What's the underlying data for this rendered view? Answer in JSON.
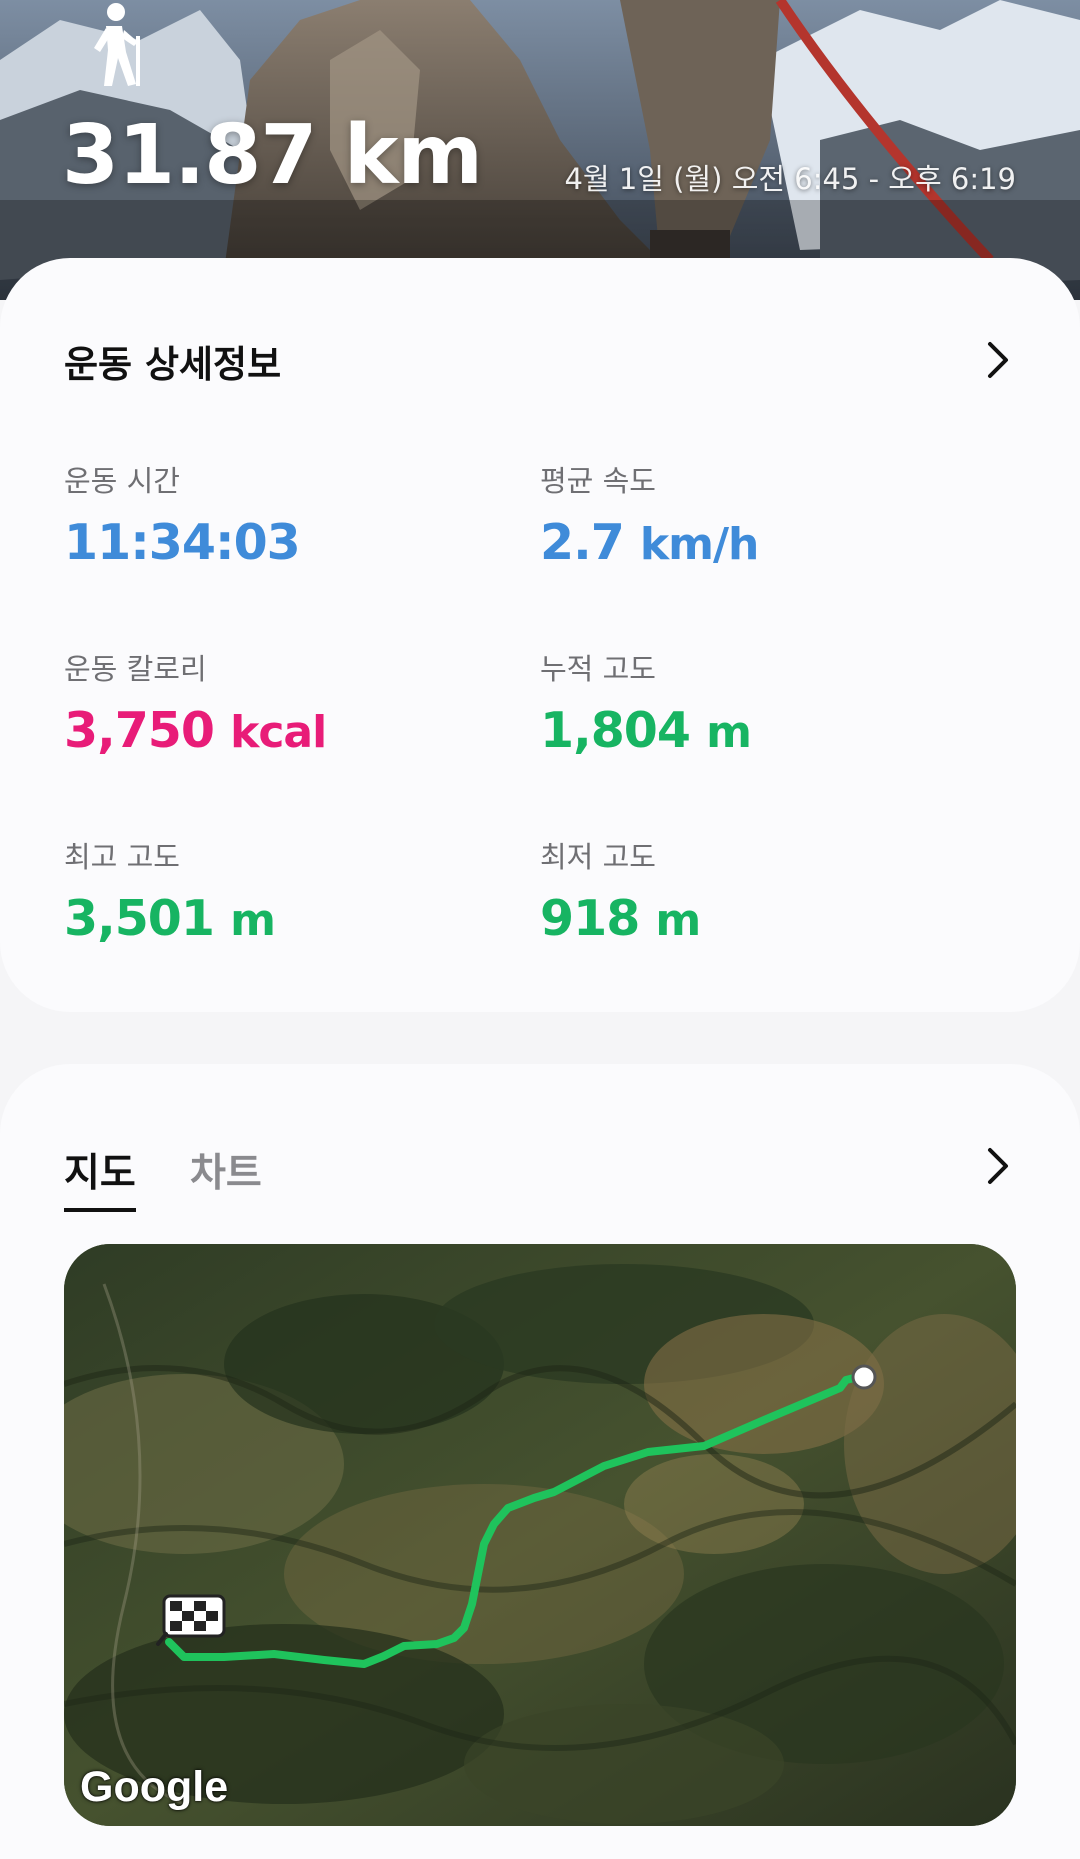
{
  "hero": {
    "distance": "31.87 km",
    "date_range": "4월 1일 (월) 오전 6:45 - 오후 6:19",
    "activity_icon": "hiking-icon"
  },
  "details": {
    "title": "운동 상세정보",
    "stats": [
      {
        "label": "운동 시간",
        "value": "11:34:03",
        "unit": "",
        "color": "#3f8bd9"
      },
      {
        "label": "평균 속도",
        "value": "2.7",
        "unit": "km/h",
        "color": "#3f8bd9"
      },
      {
        "label": "운동 칼로리",
        "value": "3,750",
        "unit": "kcal",
        "color": "#e81c78"
      },
      {
        "label": "누적 고도",
        "value": "1,804",
        "unit": "m",
        "color": "#17b462"
      },
      {
        "label": "최고 고도",
        "value": "3,501",
        "unit": "m",
        "color": "#17b462"
      },
      {
        "label": "최저 고도",
        "value": "918",
        "unit": "m",
        "color": "#17b462"
      }
    ]
  },
  "map_section": {
    "tabs": [
      {
        "label": "지도",
        "active": true
      },
      {
        "label": "차트",
        "active": false
      }
    ],
    "attribution": "Google",
    "route_color": "#1fc35c",
    "finish_icon": "checkered-flag-icon",
    "start_icon": "start-point-icon"
  }
}
